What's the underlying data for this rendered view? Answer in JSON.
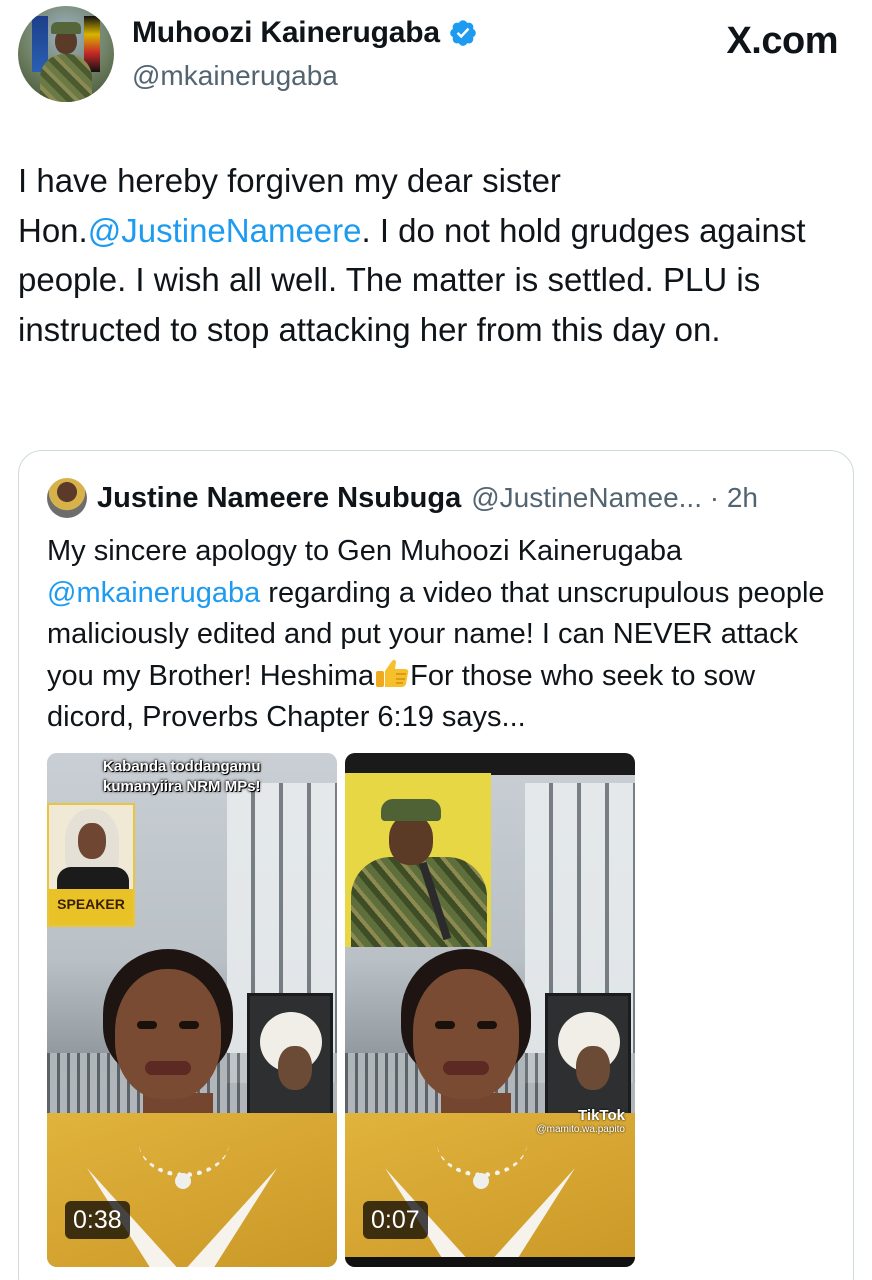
{
  "header": {
    "name": "Muhoozi Kainerugaba",
    "handle": "@mkainerugaba",
    "brand": "X.com",
    "verified": true
  },
  "tweet": {
    "text_before": "I have hereby forgiven my dear sister Hon.",
    "mention": "@JustineNameere",
    "text_after": ". I do not hold grudges against people. I wish all well. The matter is settled. PLU is instructed to stop attacking her from this day on."
  },
  "quote": {
    "name": "Justine Nameere Nsubuga",
    "handle_time": "@JustineNamee... · 2h",
    "text_1": "My sincere apology to Gen Muhoozi Kainerugaba",
    "mention": "@mkainerugaba",
    "text_2": " regarding a video that unscrupulous people maliciously edited and put your name! I can NEVER attack you my Brother! Heshima",
    "emoji": "thumbs-up",
    "text_3": "For those who seek to sow dicord, Proverbs Chapter 6:19 says...",
    "media": [
      {
        "caption": "Kabanda toddangamu kumanyiira NRM MPs!",
        "badge": "SPEAKER",
        "duration": "0:38"
      },
      {
        "watermark": "TikTok",
        "watermark_user": "@mamito.wa.papito",
        "duration": "0:07"
      }
    ]
  },
  "colors": {
    "link": "#1d9bf0",
    "verified": "#1d9bf0",
    "text": "#0f1419",
    "muted": "#536471",
    "border": "#cfd9de"
  }
}
